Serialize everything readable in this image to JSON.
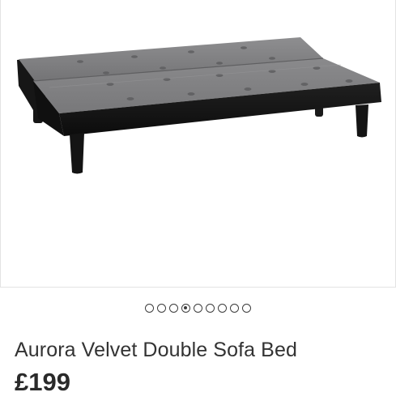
{
  "product": {
    "title": "Aurora Velvet Double Sofa Bed",
    "price": "£199"
  },
  "gallery": {
    "image_count": 9,
    "active_index": 3
  },
  "colors": {
    "velvet_grey": "#7b7b7d",
    "frame_black": "#151515",
    "text": "#2b2b2b"
  }
}
